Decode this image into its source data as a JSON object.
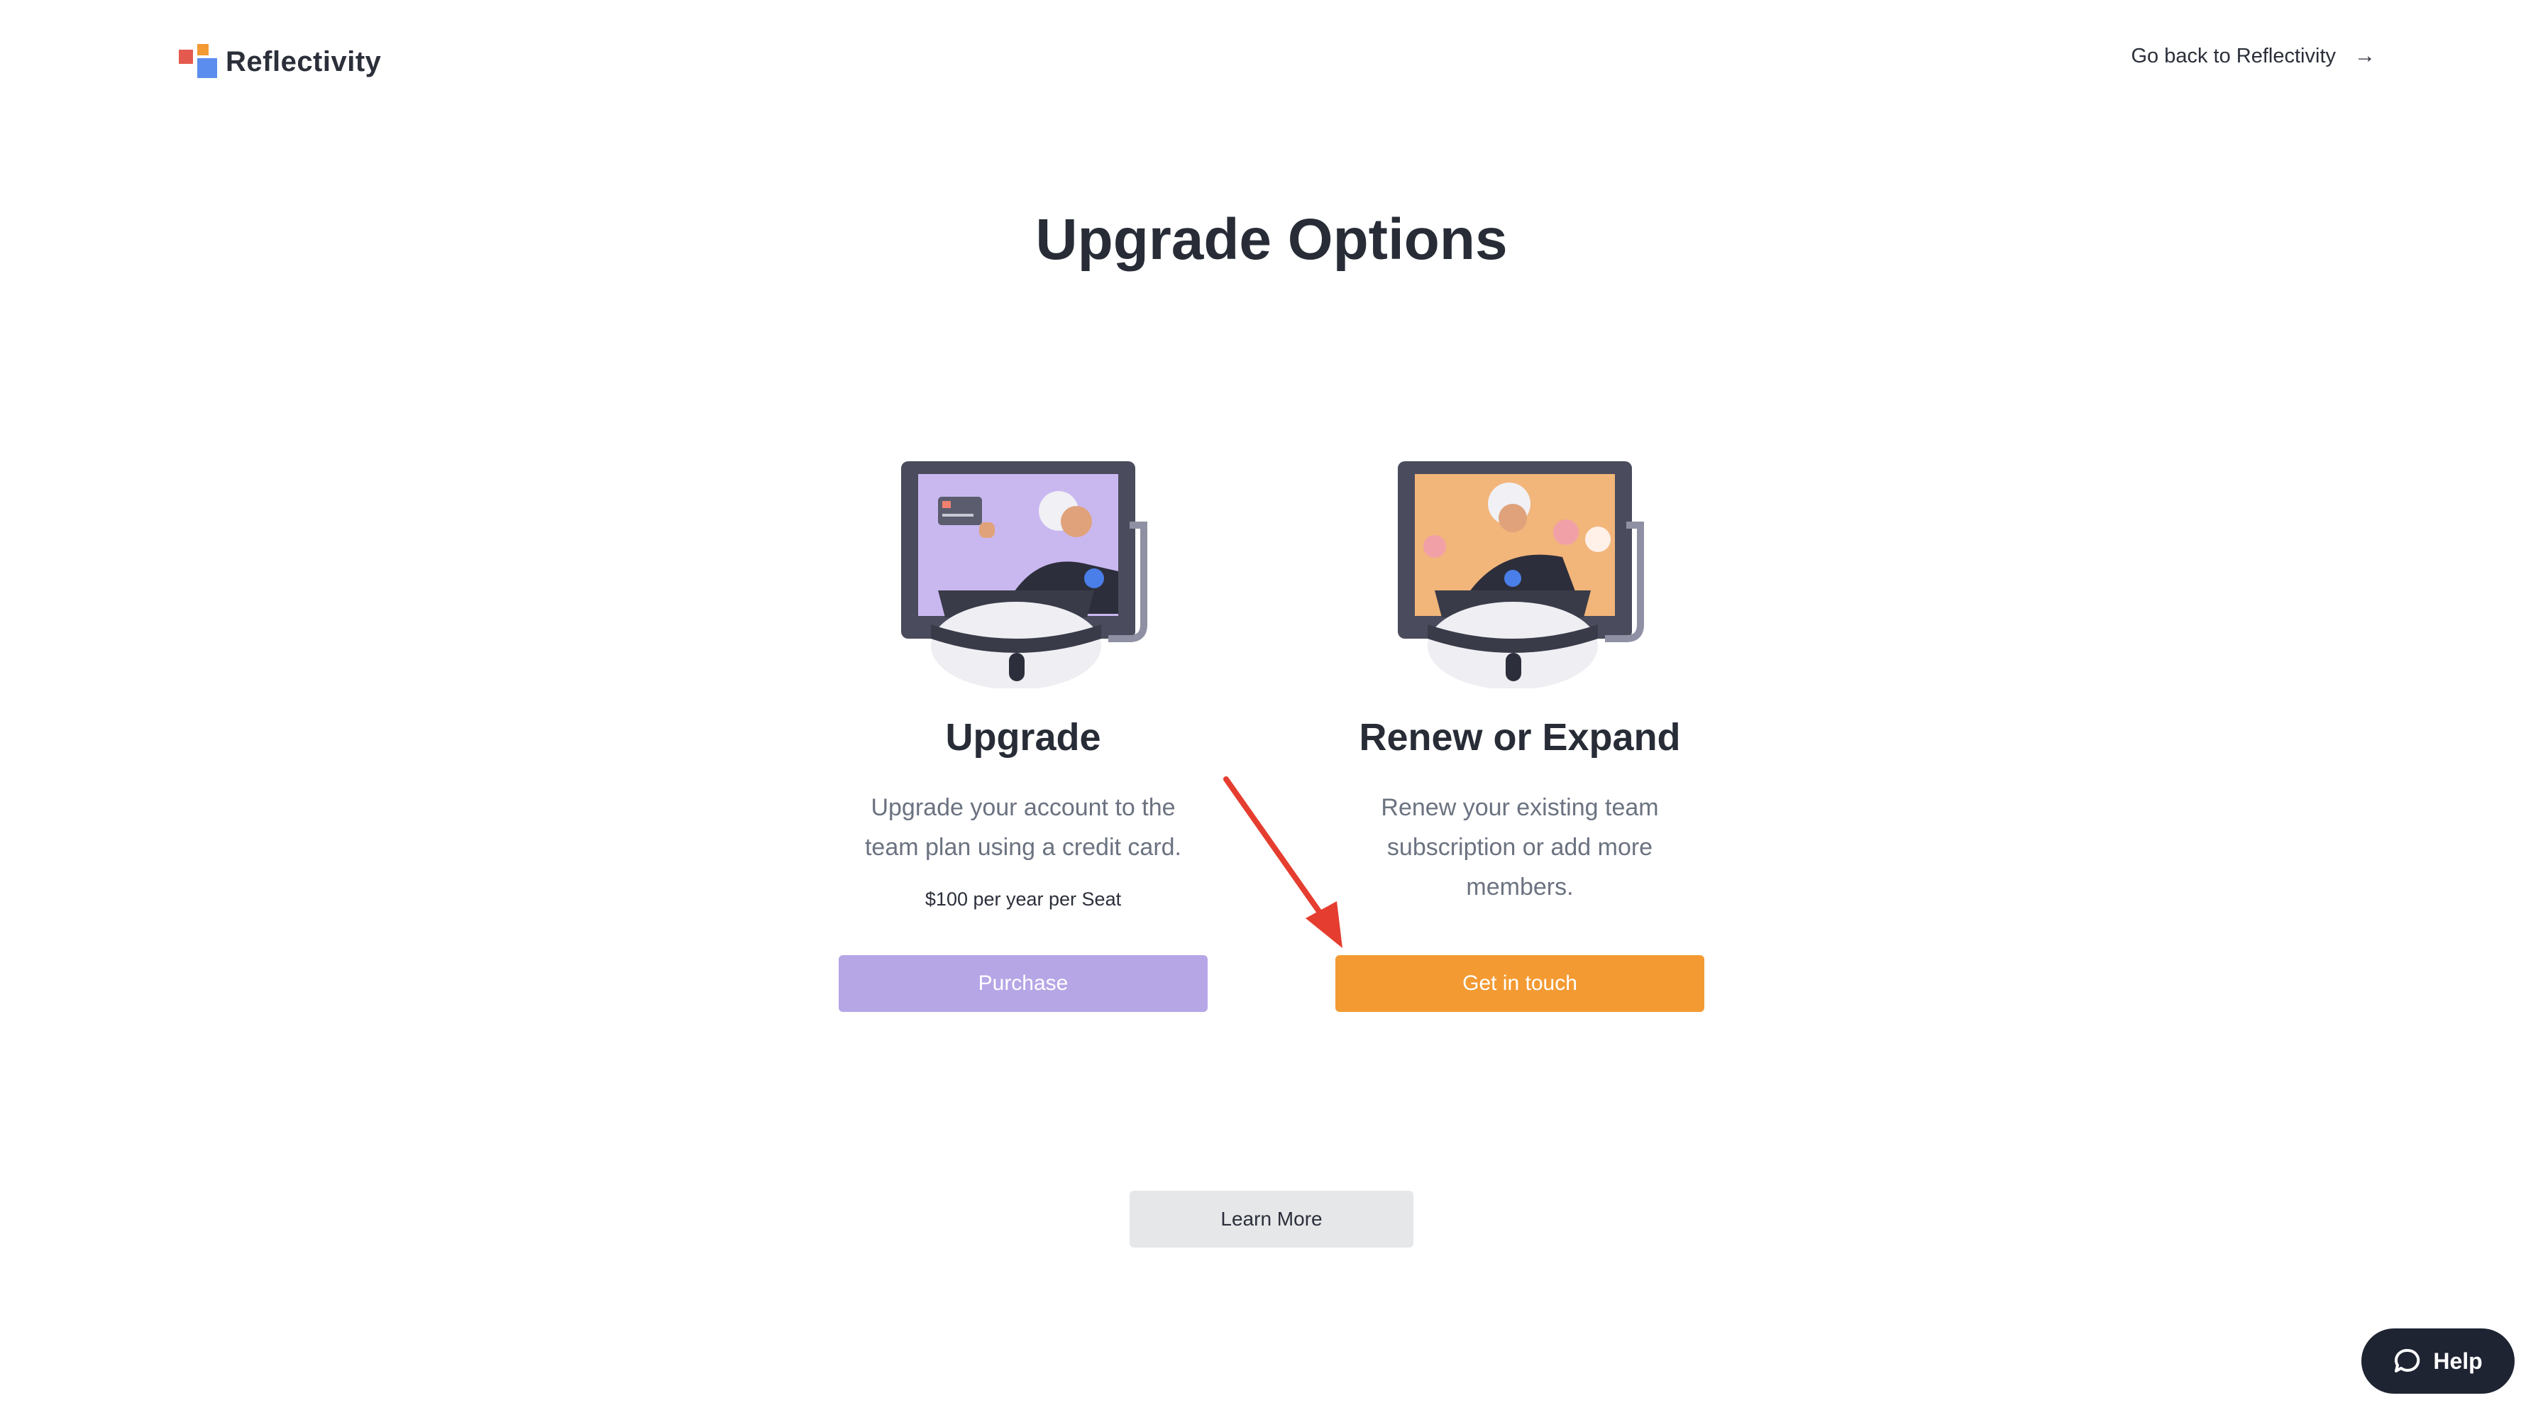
{
  "header": {
    "brand": "Reflectivity",
    "go_back_label": "Go back to Reflectivity",
    "go_back_icon": "arrow-right-icon"
  },
  "page": {
    "title": "Upgrade Options"
  },
  "options": [
    {
      "title": "Upgrade",
      "description": "Upgrade your account to the team plan using a credit card.",
      "price": "$100 per year per Seat",
      "button_label": "Purchase",
      "button_color": "#b6a6e6"
    },
    {
      "title": "Renew or Expand",
      "description": "Renew your existing team subscription or add more members.",
      "button_label": "Get in touch",
      "button_color": "#f39a33"
    }
  ],
  "footer": {
    "learn_more_label": "Learn More"
  },
  "help": {
    "label": "Help",
    "icon": "chat-bubble-icon"
  },
  "colors": {
    "brand_red": "#e55a4e",
    "brand_orange": "#f39a33",
    "brand_blue": "#5b8def",
    "annotation_arrow": "#e53d2f"
  }
}
